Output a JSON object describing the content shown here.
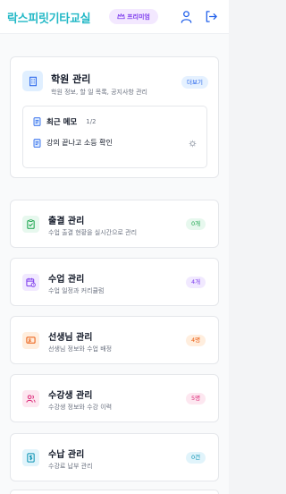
{
  "header": {
    "brand": "락스피릿기타교실",
    "premium_label": "프리미엄"
  },
  "academy": {
    "title": "학원 관리",
    "subtitle": "학원 정보, 할 일 목록, 공지사항 관리",
    "more_label": "더보기",
    "memo": {
      "title": "최근 메모",
      "count": "1/2",
      "item": "강의 끝나고 소등 확인"
    }
  },
  "menus": [
    {
      "title": "출결 관리",
      "subtitle": "수업 출결 현황을 실시간으로 관리",
      "badge": "0개",
      "color": "#16a34a",
      "bg": "#e7f8ee"
    },
    {
      "title": "수업 관리",
      "subtitle": "수업 일정과 커리큘럼",
      "badge": "4개",
      "color": "#7c3aed",
      "bg": "#f1e9ff"
    },
    {
      "title": "선생님 관리",
      "subtitle": "선생님 정보와 수업 배정",
      "badge": "4명",
      "color": "#ea580c",
      "bg": "#ffeede"
    },
    {
      "title": "수강생 관리",
      "subtitle": "수강생 정보와 수강 이력",
      "badge": "5명",
      "color": "#db2777",
      "bg": "#fde7f0"
    },
    {
      "title": "수납 관리",
      "subtitle": "수강료 납부 관리",
      "badge": "0건",
      "color": "#0891b2",
      "bg": "#e1f4fb"
    }
  ]
}
